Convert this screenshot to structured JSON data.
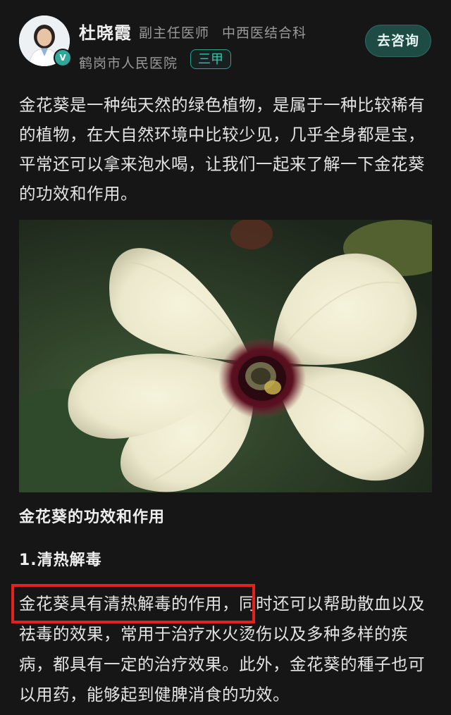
{
  "doctor": {
    "name": "杜晓霞",
    "title": "副主任医师",
    "department": "中西医结合科",
    "hospital": "鹤岗市人民医院",
    "grade": "三甲",
    "verified_icon": "V"
  },
  "actions": {
    "consult_label": "去咨询"
  },
  "article": {
    "intro": "金花葵是一种纯天然的绿色植物，是属于一种比较稀有的植物，在大自然环境中比较少见，几乎全身都是宝，平常还可以拿来泡水喝，让我们一起来了解一下金花葵的功效和作用。",
    "image_subject": "white-flower-photo",
    "section_heading": "金花葵的功效和作用",
    "sub_heading": "1.清热解毒",
    "body_highlight": "金花葵具有清热解毒的作用",
    "body_rest": "，同时还可以帮助散血以及祛毒的效果，常用于治疗水火烫伤以及多种多样的疾病，都具有一定的治疗效果。此外，金花葵的種子也可以用药，能够起到健脾消食的功效。"
  },
  "colors": {
    "background": "#161616",
    "accent": "#2aa394",
    "highlight_border": "#e0241b"
  }
}
